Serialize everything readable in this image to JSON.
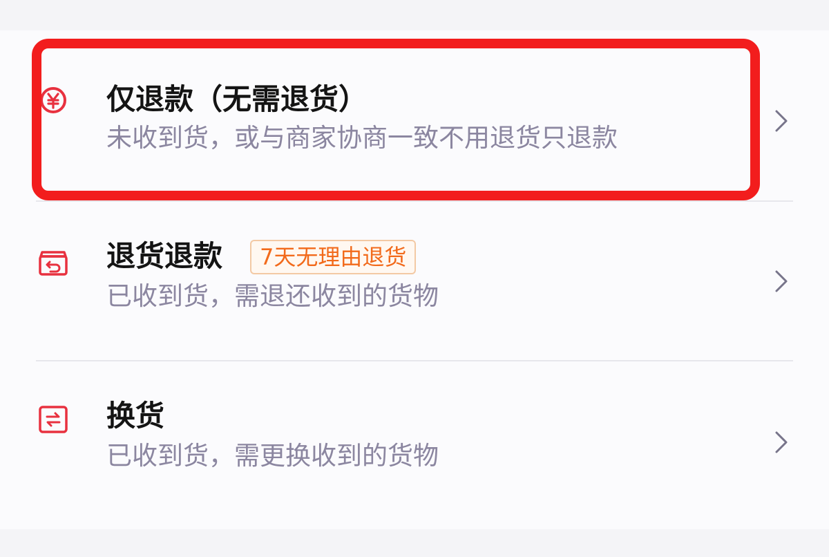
{
  "options": [
    {
      "title": "仅退款（无需退货）",
      "subtitle": "未收到货，或与商家协商一致不用退货只退款",
      "icon": "yuan-coin-icon"
    },
    {
      "title": "退货退款",
      "tag": "7天无理由退货",
      "subtitle": "已收到货，需退还收到的货物",
      "icon": "return-package-icon"
    },
    {
      "title": "换货",
      "subtitle": "已收到货，需更换收到的货物",
      "icon": "exchange-icon"
    }
  ],
  "colors": {
    "accent_red": "#e8313f",
    "highlight_border": "#f21d1d",
    "tag_orange": "#f26a1b",
    "subtitle_gray": "#8b86a0"
  }
}
